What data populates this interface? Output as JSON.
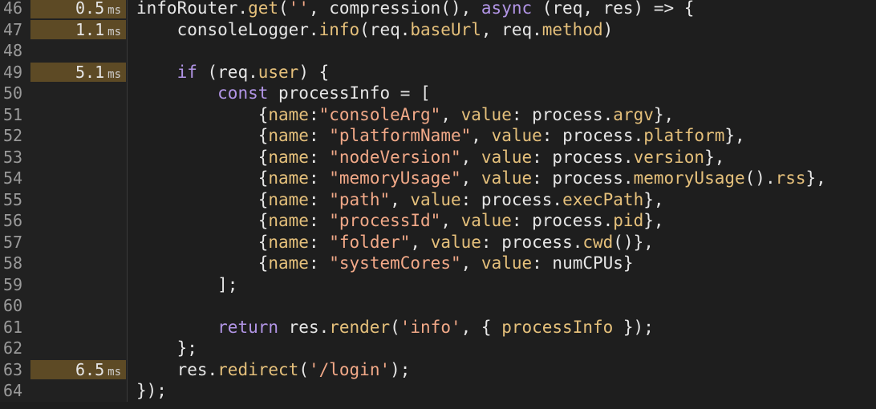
{
  "editor": {
    "lines": [
      {
        "number": "46",
        "timing": "0.5",
        "unit": "ms",
        "tokens": [
          {
            "t": "infoRouter.",
            "c": "plain"
          },
          {
            "t": "get",
            "c": "func"
          },
          {
            "t": "(",
            "c": "plain"
          },
          {
            "t": "''",
            "c": "str"
          },
          {
            "t": ", compression(), ",
            "c": "plain"
          },
          {
            "t": "async",
            "c": "kw"
          },
          {
            "t": " (req, res) => {",
            "c": "plain"
          }
        ]
      },
      {
        "number": "47",
        "timing": "1.1",
        "unit": "ms",
        "tokens": [
          {
            "t": "    consoleLogger.",
            "c": "plain"
          },
          {
            "t": "info",
            "c": "func"
          },
          {
            "t": "(req.",
            "c": "plain"
          },
          {
            "t": "baseUrl",
            "c": "prop"
          },
          {
            "t": ", req.",
            "c": "plain"
          },
          {
            "t": "method",
            "c": "prop"
          },
          {
            "t": ")",
            "c": "plain"
          }
        ]
      },
      {
        "number": "48",
        "timing": "",
        "unit": "",
        "tokens": []
      },
      {
        "number": "49",
        "timing": "5.1",
        "unit": "ms",
        "tokens": [
          {
            "t": "    ",
            "c": "plain"
          },
          {
            "t": "if",
            "c": "kw"
          },
          {
            "t": " (req.",
            "c": "plain"
          },
          {
            "t": "user",
            "c": "prop"
          },
          {
            "t": ") {",
            "c": "plain"
          }
        ]
      },
      {
        "number": "50",
        "timing": "",
        "unit": "",
        "tokens": [
          {
            "t": "        ",
            "c": "plain"
          },
          {
            "t": "const",
            "c": "kw"
          },
          {
            "t": " processInfo = [",
            "c": "plain"
          }
        ]
      },
      {
        "number": "51",
        "timing": "",
        "unit": "",
        "tokens": [
          {
            "t": "            {",
            "c": "plain"
          },
          {
            "t": "name",
            "c": "prop"
          },
          {
            "t": ":",
            "c": "plain"
          },
          {
            "t": "\"consoleArg\"",
            "c": "str"
          },
          {
            "t": ", ",
            "c": "plain"
          },
          {
            "t": "value",
            "c": "prop"
          },
          {
            "t": ": process.",
            "c": "plain"
          },
          {
            "t": "argv",
            "c": "prop"
          },
          {
            "t": "},",
            "c": "plain"
          }
        ]
      },
      {
        "number": "52",
        "timing": "",
        "unit": "",
        "tokens": [
          {
            "t": "            {",
            "c": "plain"
          },
          {
            "t": "name",
            "c": "prop"
          },
          {
            "t": ": ",
            "c": "plain"
          },
          {
            "t": "\"platformName\"",
            "c": "str"
          },
          {
            "t": ", ",
            "c": "plain"
          },
          {
            "t": "value",
            "c": "prop"
          },
          {
            "t": ": process.",
            "c": "plain"
          },
          {
            "t": "platform",
            "c": "prop"
          },
          {
            "t": "},",
            "c": "plain"
          }
        ]
      },
      {
        "number": "53",
        "timing": "",
        "unit": "",
        "tokens": [
          {
            "t": "            {",
            "c": "plain"
          },
          {
            "t": "name",
            "c": "prop"
          },
          {
            "t": ": ",
            "c": "plain"
          },
          {
            "t": "\"nodeVersion\"",
            "c": "str"
          },
          {
            "t": ", ",
            "c": "plain"
          },
          {
            "t": "value",
            "c": "prop"
          },
          {
            "t": ": process.",
            "c": "plain"
          },
          {
            "t": "version",
            "c": "prop"
          },
          {
            "t": "},",
            "c": "plain"
          }
        ]
      },
      {
        "number": "54",
        "timing": "",
        "unit": "",
        "tokens": [
          {
            "t": "            {",
            "c": "plain"
          },
          {
            "t": "name",
            "c": "prop"
          },
          {
            "t": ": ",
            "c": "plain"
          },
          {
            "t": "\"memoryUsage\"",
            "c": "str"
          },
          {
            "t": ", ",
            "c": "plain"
          },
          {
            "t": "value",
            "c": "prop"
          },
          {
            "t": ": process.",
            "c": "plain"
          },
          {
            "t": "memoryUsage",
            "c": "func"
          },
          {
            "t": "().",
            "c": "plain"
          },
          {
            "t": "rss",
            "c": "prop"
          },
          {
            "t": "},",
            "c": "plain"
          }
        ]
      },
      {
        "number": "55",
        "timing": "",
        "unit": "",
        "tokens": [
          {
            "t": "            {",
            "c": "plain"
          },
          {
            "t": "name",
            "c": "prop"
          },
          {
            "t": ": ",
            "c": "plain"
          },
          {
            "t": "\"path\"",
            "c": "str"
          },
          {
            "t": ", ",
            "c": "plain"
          },
          {
            "t": "value",
            "c": "prop"
          },
          {
            "t": ": process.",
            "c": "plain"
          },
          {
            "t": "execPath",
            "c": "prop"
          },
          {
            "t": "},",
            "c": "plain"
          }
        ]
      },
      {
        "number": "56",
        "timing": "",
        "unit": "",
        "tokens": [
          {
            "t": "            {",
            "c": "plain"
          },
          {
            "t": "name",
            "c": "prop"
          },
          {
            "t": ": ",
            "c": "plain"
          },
          {
            "t": "\"processId\"",
            "c": "str"
          },
          {
            "t": ", ",
            "c": "plain"
          },
          {
            "t": "value",
            "c": "prop"
          },
          {
            "t": ": process.",
            "c": "plain"
          },
          {
            "t": "pid",
            "c": "prop"
          },
          {
            "t": "},",
            "c": "plain"
          }
        ]
      },
      {
        "number": "57",
        "timing": "",
        "unit": "",
        "tokens": [
          {
            "t": "            {",
            "c": "plain"
          },
          {
            "t": "name",
            "c": "prop"
          },
          {
            "t": ": ",
            "c": "plain"
          },
          {
            "t": "\"folder\"",
            "c": "str"
          },
          {
            "t": ", ",
            "c": "plain"
          },
          {
            "t": "value",
            "c": "prop"
          },
          {
            "t": ": process.",
            "c": "plain"
          },
          {
            "t": "cwd",
            "c": "func"
          },
          {
            "t": "()},",
            "c": "plain"
          }
        ]
      },
      {
        "number": "58",
        "timing": "",
        "unit": "",
        "tokens": [
          {
            "t": "            {",
            "c": "plain"
          },
          {
            "t": "name",
            "c": "prop"
          },
          {
            "t": ": ",
            "c": "plain"
          },
          {
            "t": "\"systemCores\"",
            "c": "str"
          },
          {
            "t": ", ",
            "c": "plain"
          },
          {
            "t": "value",
            "c": "prop"
          },
          {
            "t": ": numCPUs}",
            "c": "plain"
          }
        ]
      },
      {
        "number": "59",
        "timing": "",
        "unit": "",
        "tokens": [
          {
            "t": "        ];",
            "c": "plain"
          }
        ]
      },
      {
        "number": "60",
        "timing": "",
        "unit": "",
        "tokens": []
      },
      {
        "number": "61",
        "timing": "",
        "unit": "",
        "tokens": [
          {
            "t": "        ",
            "c": "plain"
          },
          {
            "t": "return",
            "c": "kw"
          },
          {
            "t": " res.",
            "c": "plain"
          },
          {
            "t": "render",
            "c": "func"
          },
          {
            "t": "(",
            "c": "plain"
          },
          {
            "t": "'info'",
            "c": "str"
          },
          {
            "t": ", { ",
            "c": "plain"
          },
          {
            "t": "processInfo",
            "c": "prop"
          },
          {
            "t": " });",
            "c": "plain"
          }
        ]
      },
      {
        "number": "62",
        "timing": "",
        "unit": "",
        "tokens": [
          {
            "t": "    };",
            "c": "plain"
          }
        ]
      },
      {
        "number": "63",
        "timing": "6.5",
        "unit": "ms",
        "tokens": [
          {
            "t": "    res.",
            "c": "plain"
          },
          {
            "t": "redirect",
            "c": "func"
          },
          {
            "t": "(",
            "c": "plain"
          },
          {
            "t": "'/login'",
            "c": "str"
          },
          {
            "t": ");",
            "c": "plain"
          }
        ]
      },
      {
        "number": "64",
        "timing": "",
        "unit": "",
        "tokens": [
          {
            "t": "});",
            "c": "plain"
          }
        ]
      }
    ]
  },
  "colors": {
    "background": "#1e1e1e",
    "timing_bar": "#5d4a25",
    "keyword": "#b295e6",
    "string": "#f2a988",
    "function": "#e5c07b"
  }
}
